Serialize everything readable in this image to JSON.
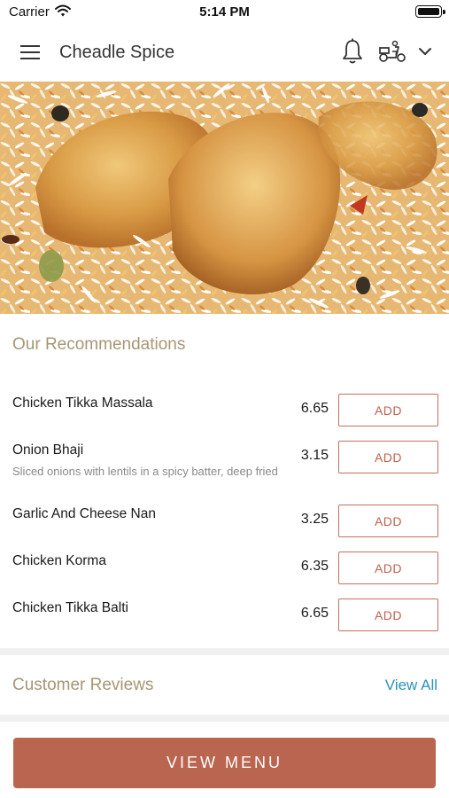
{
  "status_bar": {
    "carrier": "Carrier",
    "time": "5:14 PM"
  },
  "header": {
    "title": "Cheadle Spice",
    "icons": [
      "hamburger-menu-icon",
      "bell-icon",
      "scooter-icon",
      "chevron-down-icon"
    ]
  },
  "hero": {
    "description": "chicken biryani photo"
  },
  "recommendations": {
    "title": "Our Recommendations",
    "items": [
      {
        "name": "Chicken Tikka Massala",
        "description": "",
        "price": "6.65",
        "add_label": "ADD"
      },
      {
        "name": "Onion Bhaji",
        "description": "Sliced onions with lentils in a spicy batter, deep fried",
        "price": "3.15",
        "add_label": "ADD"
      },
      {
        "name": "Garlic And Cheese Nan",
        "description": "",
        "price": "3.25",
        "add_label": "ADD"
      },
      {
        "name": "Chicken Korma",
        "description": "",
        "price": "6.35",
        "add_label": "ADD"
      },
      {
        "name": "Chicken Tikka Balti",
        "description": "",
        "price": "6.65",
        "add_label": "ADD"
      }
    ]
  },
  "reviews": {
    "title": "Customer Reviews",
    "view_all_label": "View All"
  },
  "footer": {
    "view_menu_label": "VIEW MENU"
  },
  "colors": {
    "accent": "#b9654f",
    "section_title": "#a79673",
    "link": "#2b93b7"
  }
}
